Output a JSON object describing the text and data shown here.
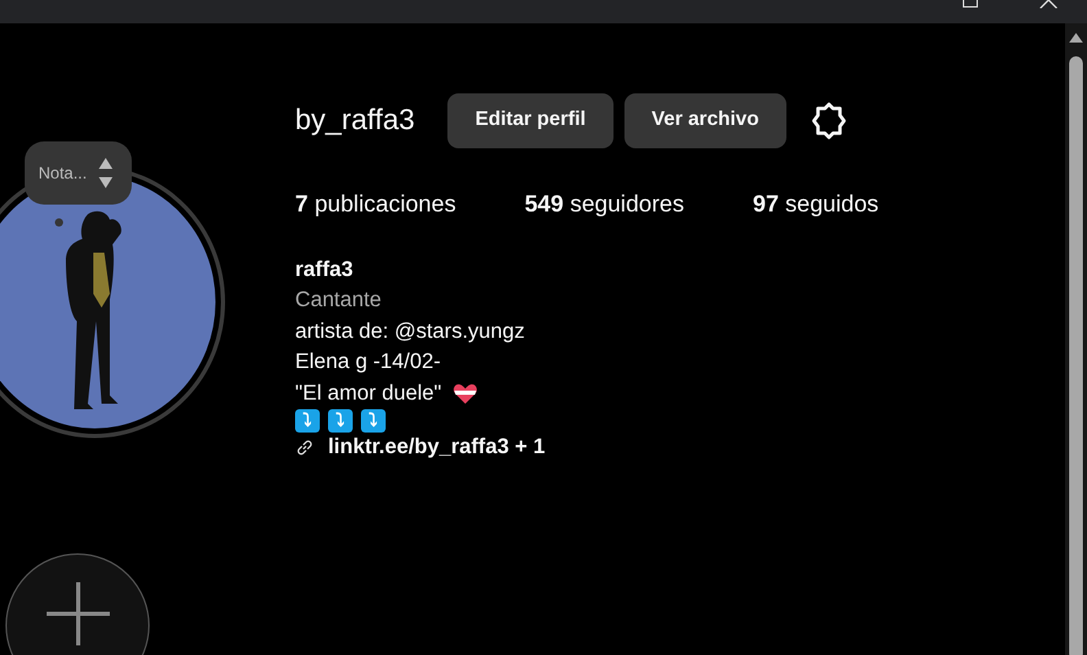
{
  "note": {
    "placeholder": "Nota..."
  },
  "profile": {
    "username": "by_raffa3",
    "buttons": [
      "Editar perfil",
      "Ver archivo"
    ],
    "stats": [
      {
        "count": "7",
        "label": "publicaciones"
      },
      {
        "count": "549",
        "label": "seguidores"
      },
      {
        "count": "97",
        "label": "seguidos"
      }
    ],
    "name": "raffa3",
    "category": "Cantante",
    "bio_lines": [
      "artista de: @stars.yungz",
      "Elena g -14/02-",
      "\"El amor duele\""
    ],
    "arrow_emojis": [
      "⤵",
      "⤵",
      "⤵"
    ],
    "link": "linktr.ee/by_raffa3 + 1"
  }
}
